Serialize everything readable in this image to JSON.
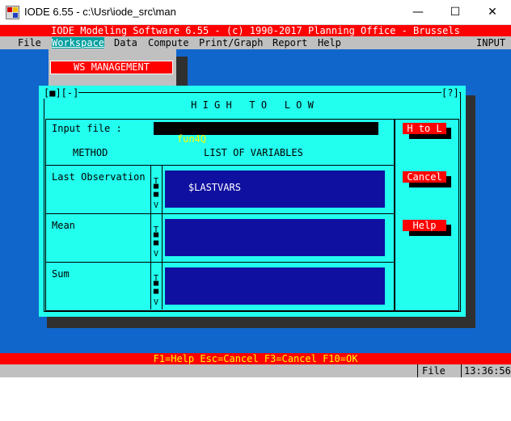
{
  "window": {
    "title": "IODE 6.55 - c:\\Usr\\iode_src\\man",
    "minimize": "—",
    "maximize": "☐",
    "close": "✕"
  },
  "banner": "IODE Modeling Software 6.55 - (c) 1990-2017 Planning Office - Brussels",
  "menu": {
    "items": [
      "File",
      "Workspace",
      "Data",
      "Compute",
      "Print/Graph",
      "Report",
      "Help"
    ],
    "selected": "Workspace",
    "mode": "INPUT"
  },
  "ws_management": "WS MANAGEMENT",
  "dialog": {
    "corner_left": "[■][-]",
    "corner_right": "[?]",
    "title": "H I G H   T O   L O W",
    "input_label": "Input file :",
    "input_value": "fun4Q",
    "method_header": "METHOD",
    "vars_header": "LIST OF VARIABLES",
    "rows": [
      {
        "label": "Last Observation",
        "value": "$LASTVARS"
      },
      {
        "label": "Mean",
        "value": ""
      },
      {
        "label": "Sum",
        "value": ""
      }
    ],
    "buttons": {
      "ok": "H to L",
      "cancel": "Cancel",
      "help": "Help"
    }
  },
  "fkeys": "F1=Help Esc=Cancel F3=Cancel F10=OK",
  "status": {
    "file": "File",
    "time": "13:36:56"
  },
  "colors": {
    "client": "#1166cc",
    "dialog": "#22ffee",
    "accent": "#ff0000",
    "field": "#1010a0"
  }
}
